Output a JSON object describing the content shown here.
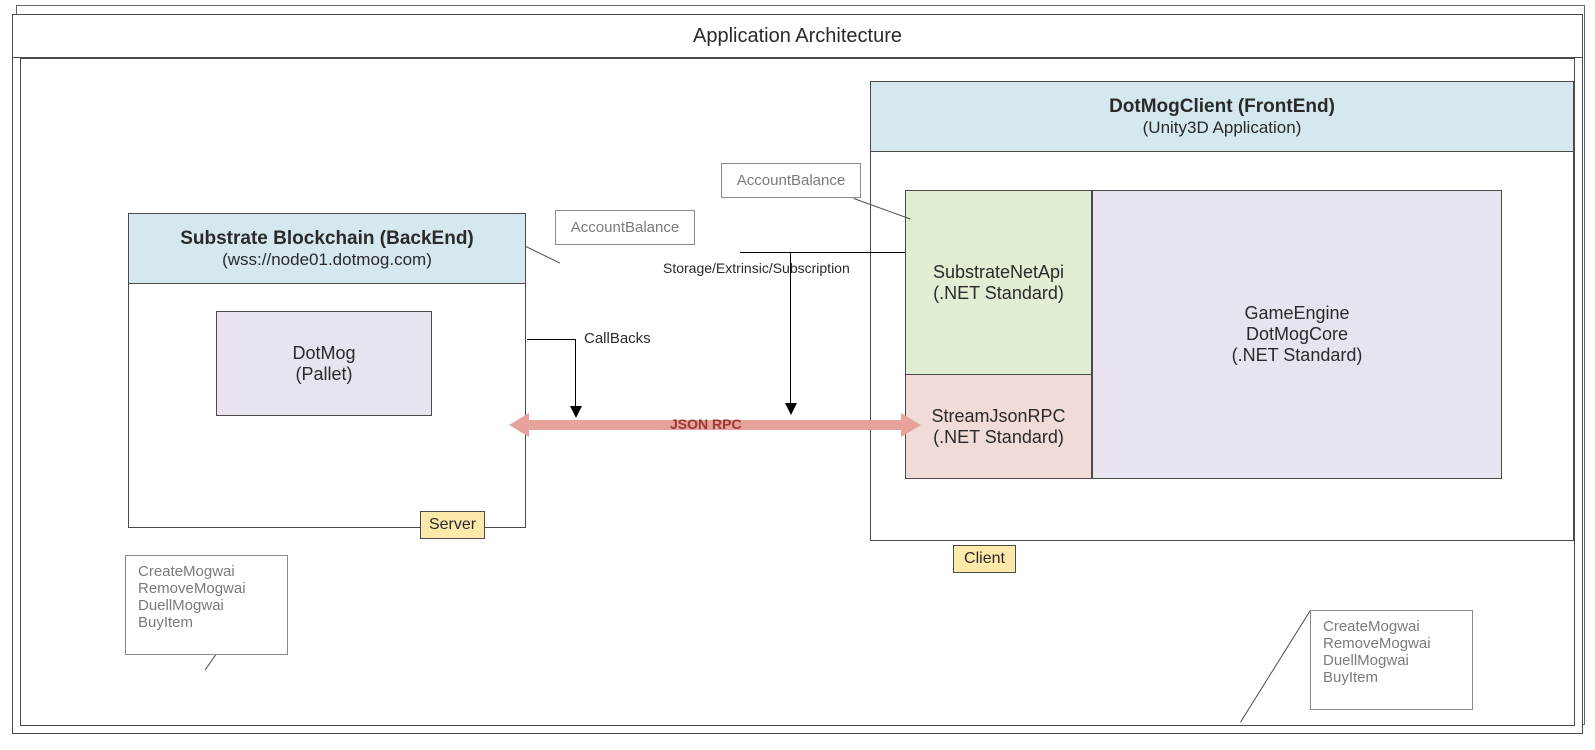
{
  "title": "Application Architecture",
  "server": {
    "title": "Substrate Blockchain (BackEnd)",
    "subtitle": "(wss://node01.dotmog.com)",
    "label": "Server",
    "pallet": {
      "name": "DotMog",
      "kind": "(Pallet)"
    },
    "balance_note": "AccountBalance",
    "ops": [
      "CreateMogwai",
      "RemoveMogwai",
      "DuellMogwai",
      "BuyItem"
    ]
  },
  "client": {
    "title": "DotMogClient (FrontEnd)",
    "subtitle": "(Unity3D Application)",
    "label": "Client",
    "api": {
      "name": "SubstrateNetApi",
      "framework": "(.NET Standard)"
    },
    "rpc": {
      "name": "StreamJsonRPC",
      "framework": "(.NET Standard)"
    },
    "engine": {
      "line1": "GameEngine",
      "line2": "DotMogCore",
      "framework": "(.NET Standard)"
    },
    "balance_note": "AccountBalance",
    "ops": [
      "CreateMogwai",
      "RemoveMogwai",
      "DuellMogwai",
      "BuyItem"
    ]
  },
  "links": {
    "callbacks": "CallBacks",
    "storage": "Storage/Extrinsic/Subscription",
    "jsonrpc": "JSON RPC"
  }
}
